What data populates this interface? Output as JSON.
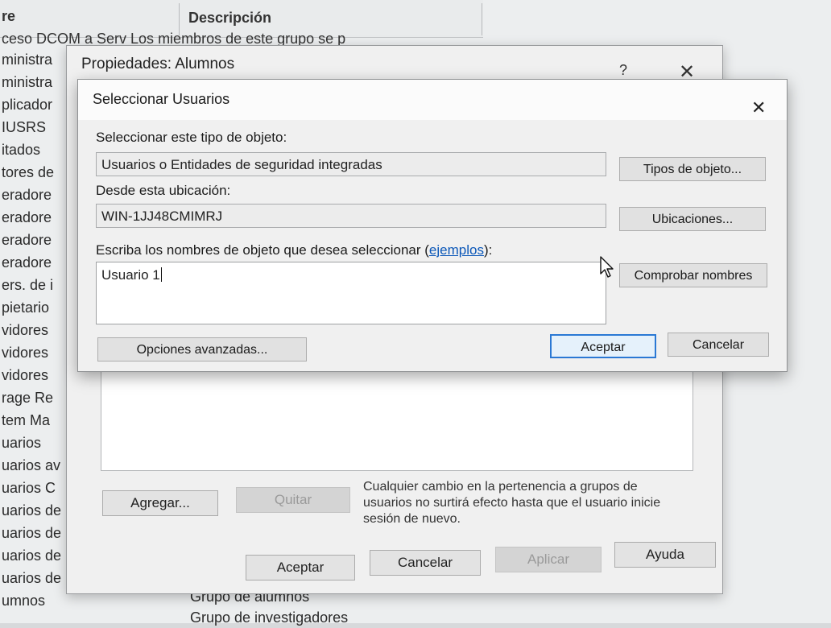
{
  "background": {
    "col_name": "re",
    "col_desc": "Descripción",
    "partial_row": "ceso DCOM a Serv    Los miembros de este grupo se p",
    "names": [
      "ministra",
      "ministra",
      "plicador",
      "IUSRS",
      "itados",
      "tores de",
      "eradore",
      "eradore",
      "eradore",
      "eradore",
      "ers. de i",
      "pietario",
      "vidores",
      "vidores",
      "vidores",
      "rage Re",
      "tem Ma",
      "uarios",
      "uarios av",
      "uarios C",
      "uarios de",
      "uarios de",
      "uarios de",
      "uarios de",
      "umnos"
    ],
    "bottom_rows": [
      "Grupo de alumnos",
      "Grupo de investigadores"
    ]
  },
  "props": {
    "title": "Propiedades: Alumnos",
    "help_icon": "?",
    "close_icon": "✕",
    "add_label": "Agregar...",
    "remove_label": "Quitar",
    "note": "Cualquier cambio en la pertenencia a grupos de usuarios no surtirá efecto hasta que el usuario inicie sesión de nuevo.",
    "ok_label": "Aceptar",
    "cancel_label": "Cancelar",
    "apply_label": "Aplicar",
    "help_label": "Ayuda"
  },
  "dialog": {
    "title": "Seleccionar Usuarios",
    "close_icon": "✕",
    "object_type_label": "Seleccionar este tipo de objeto:",
    "object_type_value": "Usuarios o Entidades de seguridad integradas",
    "object_types_button": "Tipos de objeto...",
    "location_label": "Desde esta ubicación:",
    "location_value": "WIN-1JJ48CMIMRJ",
    "locations_button": "Ubicaciones...",
    "names_label_prefix": "Escriba los nombres de objeto que desea seleccionar (",
    "names_label_link": "ejemplos",
    "names_label_suffix": "):",
    "names_value": "Usuario 1",
    "check_names_button": "Comprobar nombres",
    "advanced_button": "Opciones avanzadas...",
    "ok_button": "Aceptar",
    "cancel_button": "Cancelar"
  }
}
